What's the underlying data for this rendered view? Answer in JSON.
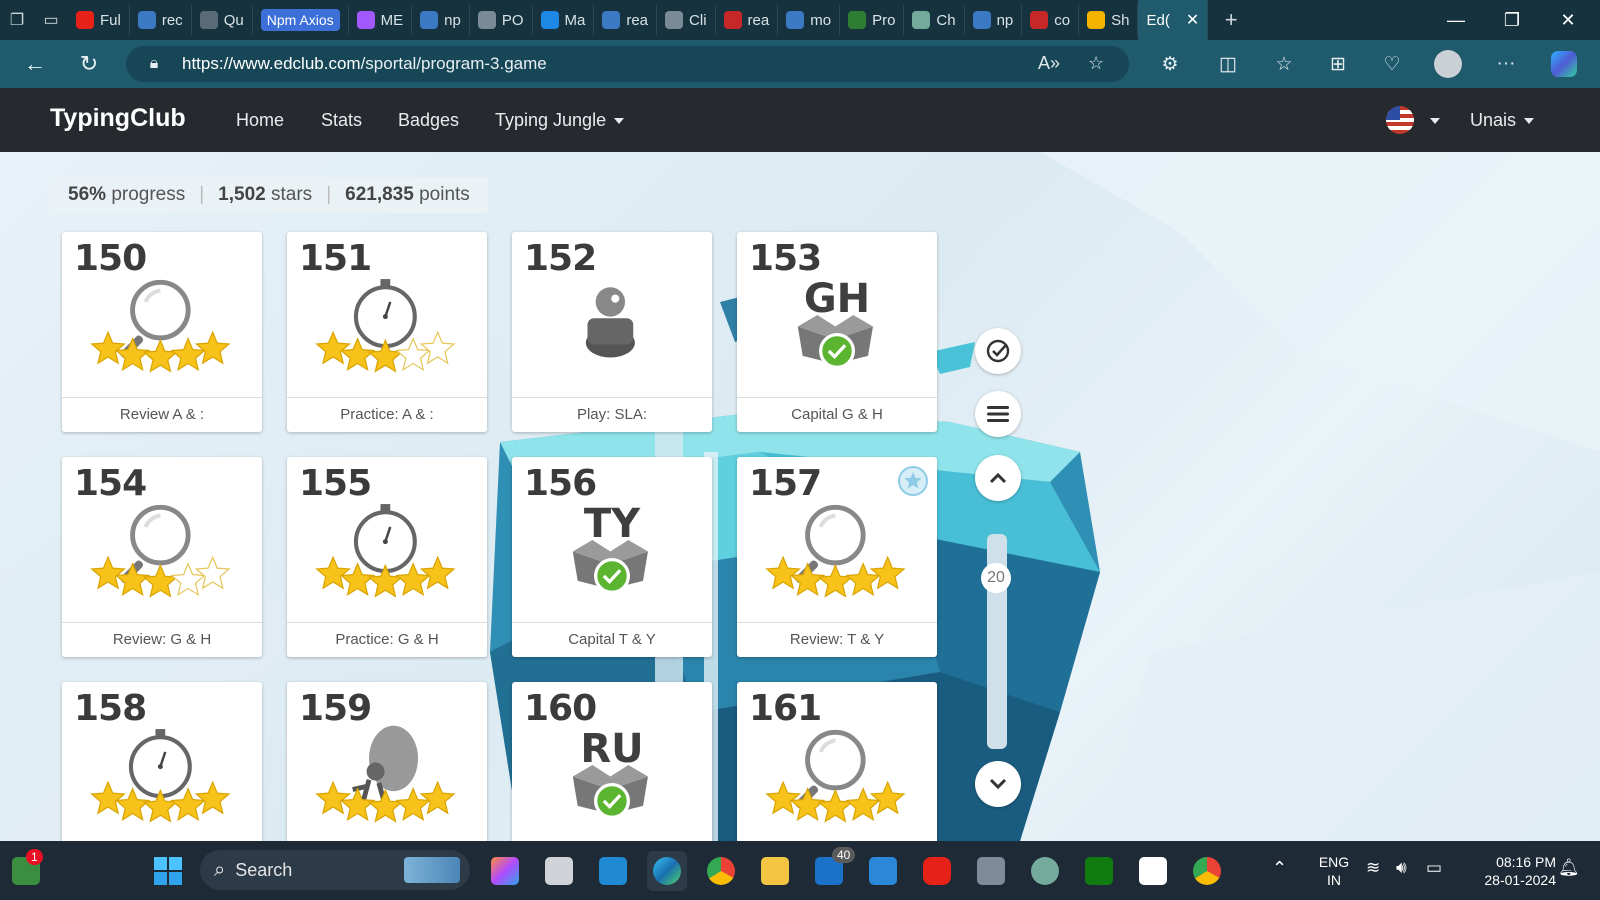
{
  "browser": {
    "tabs": [
      {
        "label": "Ful",
        "icon": "youtube-icon",
        "color": "#e62117"
      },
      {
        "label": "rec",
        "icon": "search-icon",
        "color": "#3b79c2"
      },
      {
        "label": "Qu",
        "icon": "github-icon",
        "color": "#5a6b78"
      },
      {
        "label": "Npm Axios",
        "icon": "",
        "color": "#3d6fd8"
      },
      {
        "label": "ME",
        "icon": "vite-icon",
        "color": "#a259ff"
      },
      {
        "label": "np",
        "icon": "search-icon",
        "color": "#3b79c2"
      },
      {
        "label": "PO",
        "icon": "postman-icon",
        "color": "#7a8a96"
      },
      {
        "label": "Ma",
        "icon": "mui-icon",
        "color": "#1e88e5"
      },
      {
        "label": "rea",
        "icon": "search-icon",
        "color": "#3b79c2"
      },
      {
        "label": "Cli",
        "icon": "clipboard-icon",
        "color": "#7a8a96"
      },
      {
        "label": "rea",
        "icon": "app-icon",
        "color": "#c62828"
      },
      {
        "label": "mo",
        "icon": "search-icon",
        "color": "#3b79c2"
      },
      {
        "label": "Pro",
        "icon": "mongodb-icon",
        "color": "#2e7d32"
      },
      {
        "label": "Ch",
        "icon": "chatgpt-icon",
        "color": "#74aa9c"
      },
      {
        "label": "np",
        "icon": "search-icon",
        "color": "#3b79c2"
      },
      {
        "label": "co",
        "icon": "app-icon",
        "color": "#c62828"
      },
      {
        "label": "Sh",
        "icon": "drive-icon",
        "color": "#f4b400"
      },
      {
        "label": "Ed(",
        "icon": "",
        "color": "#1f5a6d"
      }
    ],
    "url_host": "https://www.edclub.com",
    "url_path": "/sportal/program-3.game"
  },
  "site": {
    "brand": "TypingClub",
    "nav": {
      "home": "Home",
      "stats": "Stats",
      "badges": "Badges",
      "jungle": "Typing Jungle"
    },
    "user": "Unais"
  },
  "stats": {
    "progress_value": "56%",
    "progress_label": "progress",
    "stars_value": "1,502",
    "stars_label": "stars",
    "points_value": "621,835",
    "points_label": "points"
  },
  "lessons": [
    {
      "num": "150",
      "type": "magnifier",
      "stars": 5,
      "title": "Review A & :"
    },
    {
      "num": "151",
      "type": "stopwatch",
      "stars": 3,
      "title": "Practice: A & :"
    },
    {
      "num": "152",
      "type": "game",
      "stars": 0,
      "title": "Play: SLA:"
    },
    {
      "num": "153",
      "type": "capital",
      "letters": "GH",
      "stars": 0,
      "title": "Capital G & H"
    },
    {
      "num": "154",
      "type": "magnifier",
      "stars": 3,
      "title": "Review: G & H"
    },
    {
      "num": "155",
      "type": "stopwatch",
      "stars": 5,
      "title": "Practice: G & H"
    },
    {
      "num": "156",
      "type": "capital",
      "letters": "TY",
      "stars": 0,
      "title": "Capital T & Y"
    },
    {
      "num": "157",
      "type": "magnifier",
      "stars": 5,
      "title": "Review: T & Y",
      "badge": true
    },
    {
      "num": "158",
      "type": "stopwatch",
      "stars": 5,
      "title": ""
    },
    {
      "num": "159",
      "type": "game2",
      "stars": 5,
      "title": ""
    },
    {
      "num": "160",
      "type": "capital",
      "letters": "RU",
      "stars": 0,
      "title": ""
    },
    {
      "num": "161",
      "type": "magnifier",
      "stars": 5,
      "title": ""
    }
  ],
  "scroll_label": "20",
  "taskbar": {
    "search": "Search",
    "notif_count": "1",
    "mail_count": "40",
    "lang_top": "ENG",
    "lang_bottom": "IN",
    "time": "08:16 PM",
    "date": "28-01-2024"
  },
  "colors": {
    "star": "#f7c31a",
    "check": "#5cb531",
    "accent": "#3d6fd8"
  }
}
